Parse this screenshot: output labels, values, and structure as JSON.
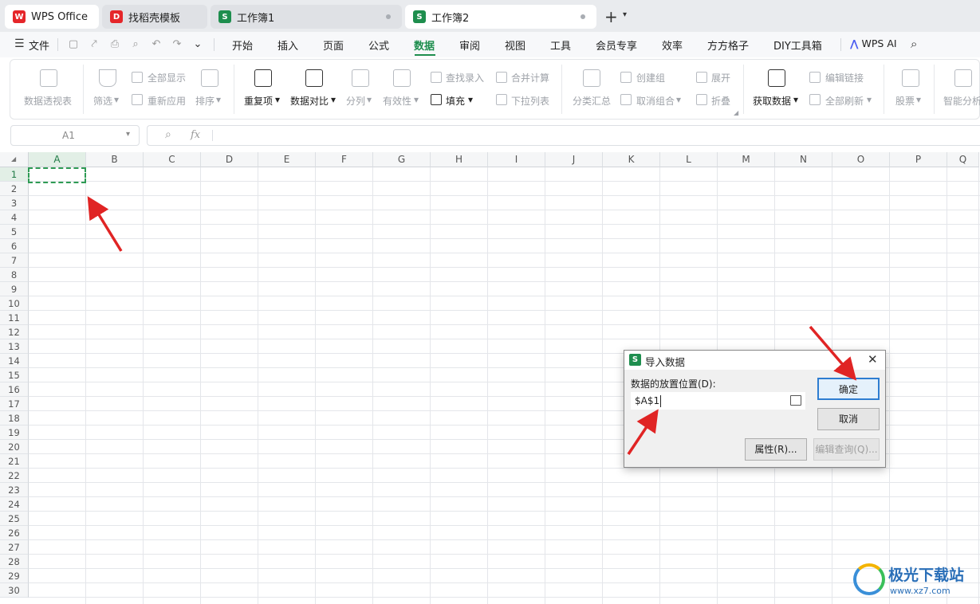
{
  "tabs": [
    {
      "label": "WPS Office",
      "color": "#e5262a",
      "icon": "W"
    },
    {
      "label": "找稻壳模板",
      "color": "#e5262a",
      "icon": "D"
    },
    {
      "label": "工作簿1",
      "color": "#1e8e4e",
      "icon": "S"
    },
    {
      "label": "工作簿2",
      "color": "#1e8e4e",
      "icon": "S"
    }
  ],
  "menu": {
    "file": "文件",
    "items": [
      "开始",
      "插入",
      "页面",
      "公式",
      "数据",
      "审阅",
      "视图",
      "工具",
      "会员专享",
      "效率",
      "方方格子",
      "DIY工具箱"
    ],
    "active": "数据",
    "wps_ai": "WPS AI"
  },
  "ribbon": {
    "pivot": "数据透视表",
    "filter": "筛选",
    "show_all": "全部显示",
    "reapply": "重新应用",
    "sort": "排序",
    "duplicates": "重复项",
    "compare": "数据对比",
    "split": "分列",
    "validity": "有效性",
    "find_entry": "查找录入",
    "fill": "填充",
    "consolidate": "合并计算",
    "dropdown": "下拉列表",
    "subtotal": "分类汇总",
    "group": "创建组",
    "ungroup": "取消组合",
    "expand": "展开",
    "collapse": "折叠",
    "get_data": "获取数据",
    "edit_links": "编辑链接",
    "refresh_all": "全部刷新",
    "stocks": "股票",
    "smart": "智能分析"
  },
  "name_box": "A1",
  "fx_label": "fx",
  "columns": [
    "A",
    "B",
    "C",
    "D",
    "E",
    "F",
    "G",
    "H",
    "I",
    "J",
    "K",
    "L",
    "M",
    "N",
    "O",
    "P",
    "Q"
  ],
  "rows": [
    "1",
    "2",
    "3",
    "4",
    "5",
    "6",
    "7",
    "8",
    "9",
    "10",
    "11",
    "12",
    "13",
    "14",
    "15",
    "16",
    "17",
    "18",
    "19",
    "20",
    "21",
    "22",
    "23",
    "24",
    "25",
    "26",
    "27",
    "28",
    "29",
    "30"
  ],
  "dialog": {
    "title": "导入数据",
    "field_label": "数据的放置位置(D):",
    "value": "$A$1",
    "ok": "确定",
    "cancel": "取消",
    "properties": "属性(R)...",
    "edit_query": "编辑查询(Q)..."
  },
  "watermark": {
    "name": "极光下载站",
    "url": "www.xz7.com"
  },
  "colors": {
    "accent": "#1e8e4e",
    "arrow": "#e02424",
    "selection": "#2e9b54"
  }
}
